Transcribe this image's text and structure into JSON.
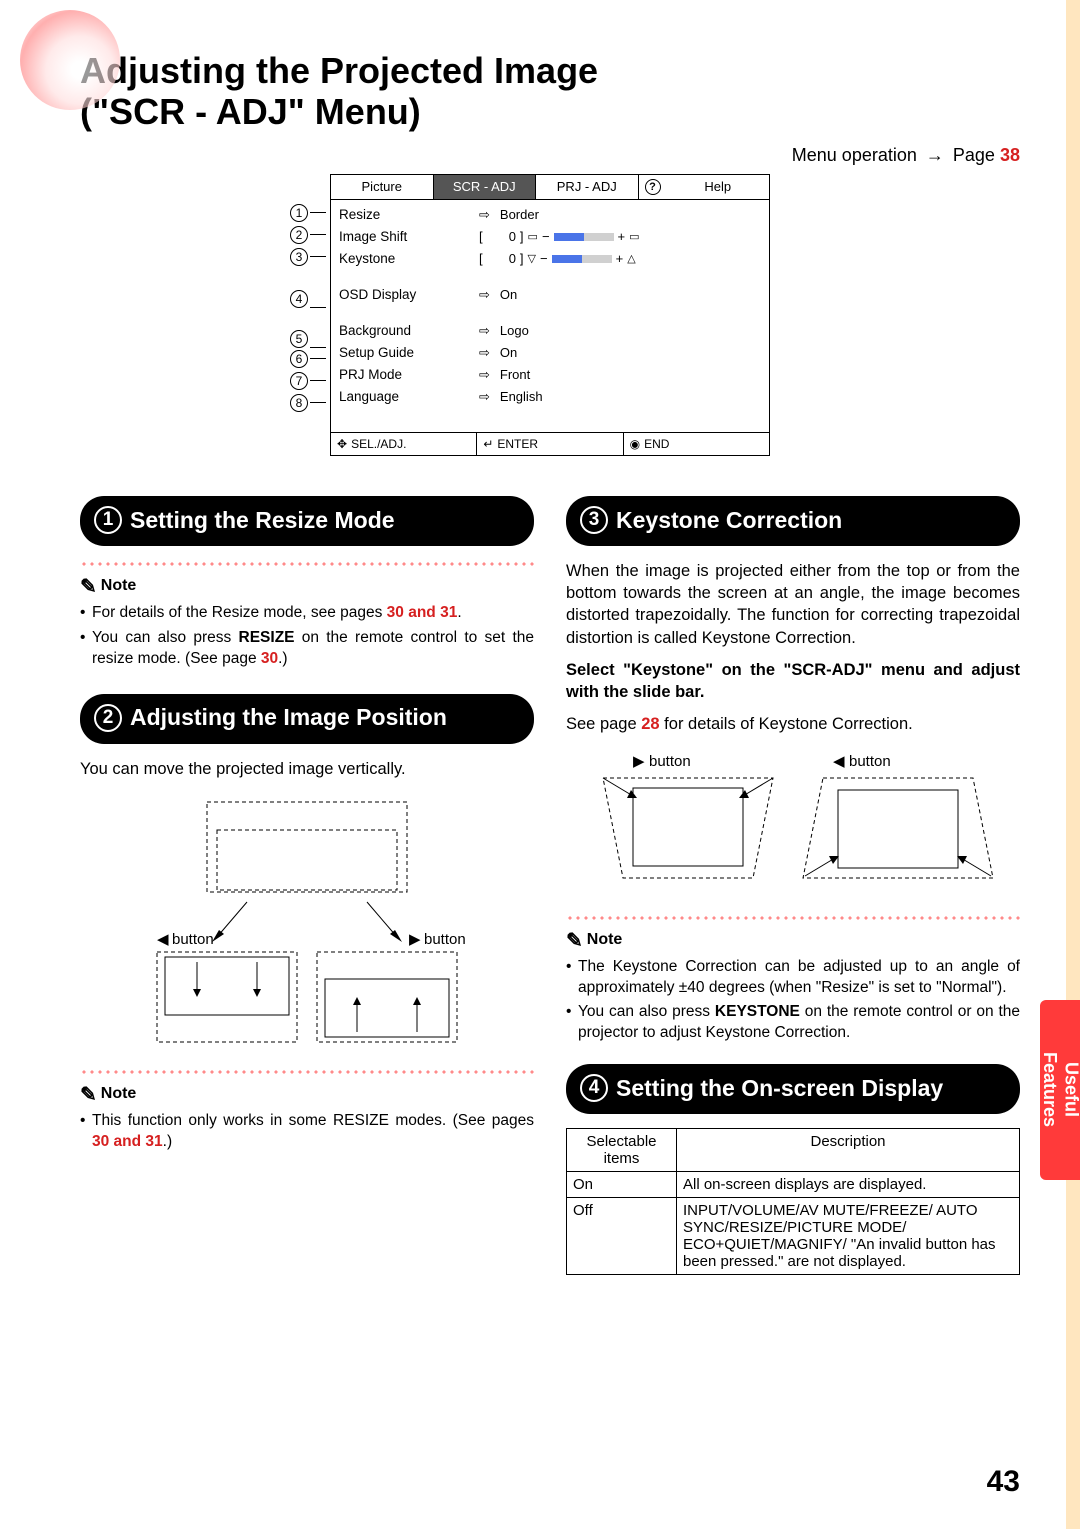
{
  "title_line1": "Adjusting the Projected Image",
  "title_line2": "(\"SCR - ADJ\" Menu)",
  "menu_operation": {
    "text": "Menu operation",
    "page_label": "Page",
    "page_num": "38"
  },
  "menu": {
    "tabs": {
      "picture": "Picture",
      "scr_adj": "SCR - ADJ",
      "prj_adj": "PRJ - ADJ",
      "help": "Help"
    },
    "rows": [
      {
        "num": "1",
        "label": "Resize",
        "value": "Border",
        "type": "enum"
      },
      {
        "num": "2",
        "label": "Image Shift",
        "value": "0",
        "type": "slider",
        "bracket": "[",
        "minus": "−",
        "plus": "+"
      },
      {
        "num": "3",
        "label": "Keystone",
        "value": "0",
        "type": "slider",
        "bracket": "[",
        "minus": "−",
        "plus": "+"
      },
      {
        "num": "4",
        "label": "OSD Display",
        "value": "On",
        "type": "enum",
        "gap": true
      },
      {
        "num": "5",
        "label": "Background",
        "value": "Logo",
        "type": "enum",
        "gap": true
      },
      {
        "num": "6",
        "label": "Setup Guide",
        "value": "On",
        "type": "enum"
      },
      {
        "num": "7",
        "label": "PRJ Mode",
        "value": "Front",
        "type": "enum"
      },
      {
        "num": "8",
        "label": "Language",
        "value": "English",
        "type": "enum"
      }
    ],
    "footer": {
      "sel": "SEL./ADJ.",
      "enter": "ENTER",
      "end": "END"
    }
  },
  "s1": {
    "title": "Setting the Resize Mode",
    "note_label": "Note",
    "bullets": [
      {
        "pre": "For details of the Resize mode, see pages ",
        "links": "30 and 31",
        "post": "."
      },
      {
        "pre": "You can also press ",
        "b": "RESIZE",
        "mid": " on the remote control to set the resize mode. (See page ",
        "link": "30",
        "post": ".)"
      }
    ]
  },
  "s2": {
    "title": "Adjusting the Image Position",
    "intro": "You can move the projected image vertically.",
    "btn_left": "button",
    "btn_right": "button",
    "note_label": "Note",
    "bullets": [
      {
        "pre": "This function only works in some RESIZE modes. (See pages ",
        "links": "30 and 31",
        "post": ".)"
      }
    ]
  },
  "s3": {
    "title": "Keystone Correction",
    "intro": "When the image is projected either from the top or from the bottom towards the screen at an angle, the image becomes distorted trapezoidally. The function for correcting trapezoidal distortion is called Keystone Correction.",
    "instruct": "Select \"Keystone\" on the \"SCR-ADJ\" menu and adjust with the slide bar.",
    "see": {
      "pre": "See page ",
      "link": "28",
      "post": " for details of Keystone Correction."
    },
    "btn_right": "button",
    "btn_left": "button",
    "note_label": "Note",
    "bullets": [
      "The Keystone Correction can be adjusted up to an angle of approximately ±40 degrees (when \"Resize\" is set to \"Normal\").",
      {
        "pre": "You can also press ",
        "b": "KEYSTONE",
        "post": " on the remote control or on the projector to adjust Keystone Correction."
      }
    ]
  },
  "s4": {
    "title": "Setting the On-screen Display",
    "table": {
      "head": {
        "c1": "Selectable items",
        "c2": "Description"
      },
      "rows": [
        {
          "c1": "On",
          "c2": "All on-screen displays are displayed."
        },
        {
          "c1": "Off",
          "c2": "INPUT/VOLUME/AV MUTE/FREEZE/ AUTO SYNC/RESIZE/PICTURE MODE/ ECO+QUIET/MAGNIFY/ \"An invalid button has been pressed.\" are not displayed."
        }
      ]
    }
  },
  "side_tab": {
    "line1": "Useful",
    "line2": "Features"
  },
  "page_number": "43"
}
